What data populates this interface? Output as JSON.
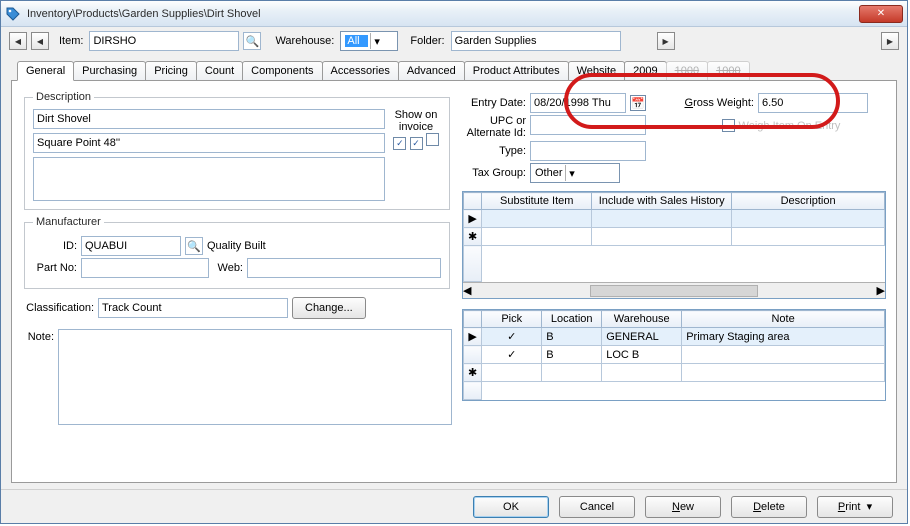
{
  "window": {
    "title": "Inventory\\Products\\Garden Supplies\\Dirt Shovel"
  },
  "toolbar": {
    "item_label": "Item:",
    "item_code": "DIRSHO",
    "warehouse_label": "Warehouse:",
    "warehouse_value": "All",
    "folder_label": "Folder:",
    "folder_value": "Garden Supplies"
  },
  "tabs": {
    "general": "General",
    "purchasing": "Purchasing",
    "pricing": "Pricing",
    "count": "Count",
    "components": "Components",
    "accessories": "Accessories",
    "advanced": "Advanced",
    "product_attributes": "Product Attributes",
    "website": "Website",
    "t2009": "2009",
    "t1000a": "1000",
    "t1000b": "1000"
  },
  "general": {
    "description_legend": "Description",
    "show_on_invoice_label": "Show on\ninvoice",
    "desc1": "Dirt Shovel",
    "desc2": "Square Point 48''",
    "desc3": "",
    "entry_date_label": "Entry Date:",
    "entry_date": "08/20/1998 Thu",
    "upc_label": "UPC or\nAlternate Id:",
    "upc": "",
    "type_label": "Type:",
    "type": "",
    "tax_group_label": "Tax Group:",
    "tax_group": "Other",
    "gross_weight_label": "Gross Weight:",
    "gross_weight": "6.50",
    "weigh_checkbox_label": "Weigh Item On Entry",
    "manufacturer_legend": "Manufacturer",
    "mfr_id_label": "ID:",
    "mfr_id": "QUABUI",
    "mfr_name": "Quality Built",
    "part_no_label": "Part No:",
    "part_no": "",
    "web_label": "Web:",
    "web": "",
    "classification_label": "Classification:",
    "classification": "Track Count",
    "change_btn": "Change...",
    "note_label": "Note:",
    "note": ""
  },
  "substitute_grid": {
    "col_item": "Substitute Item",
    "col_history": "Include with Sales History",
    "col_desc": "Description"
  },
  "location_grid": {
    "col_pick": "Pick",
    "col_location": "Location",
    "col_warehouse": "Warehouse",
    "col_note": "Note",
    "rows": [
      {
        "pick": "✓",
        "location": "B",
        "warehouse": "GENERAL",
        "note": "Primary Staging area"
      },
      {
        "pick": "✓",
        "location": "B",
        "warehouse": "LOC B",
        "note": ""
      }
    ]
  },
  "footer": {
    "ok": "OK",
    "cancel": "Cancel",
    "new": "New",
    "delete": "Delete",
    "print": "Print"
  }
}
